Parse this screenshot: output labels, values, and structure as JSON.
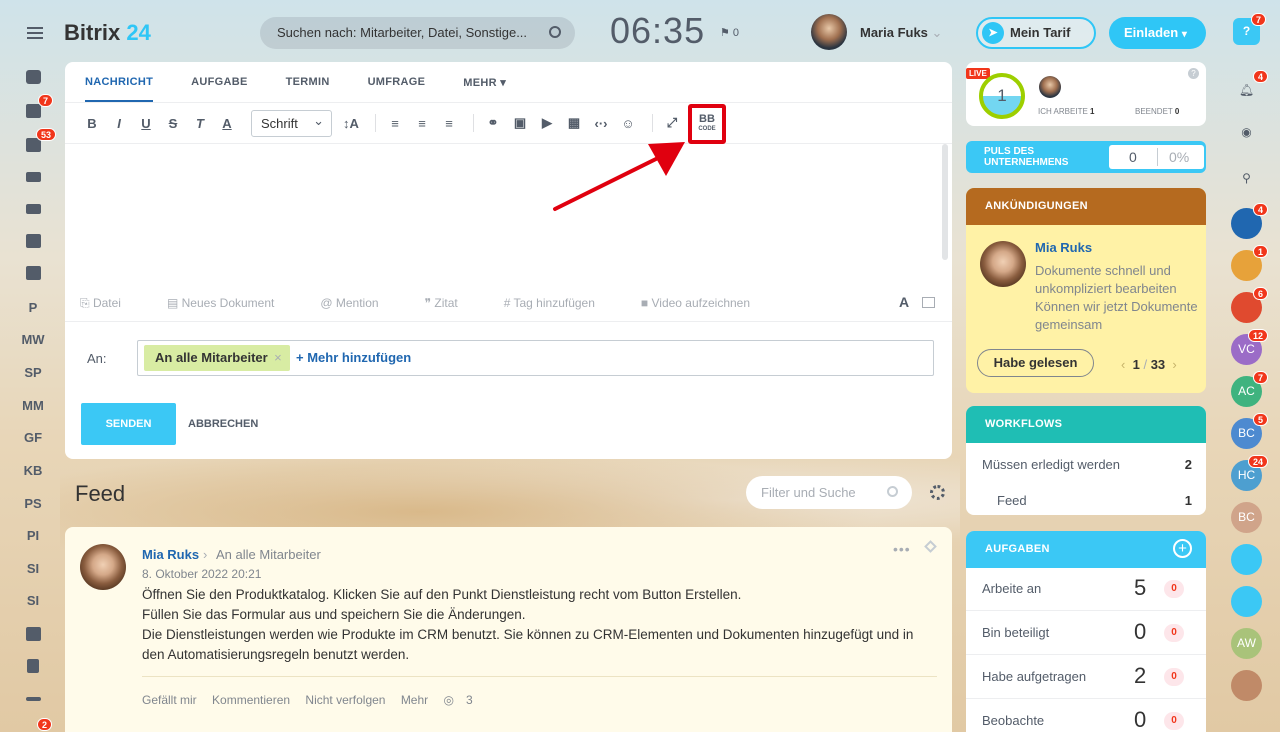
{
  "header": {
    "logo_a": "Bitrix",
    "logo_b": "24",
    "search_placeholder": "Suchen nach: Mitarbeiter, Datei, Sonstige...",
    "clock": "06:35",
    "flag_count": "0",
    "user_name": "Maria Fuks",
    "tarif_label": "Mein Tarif",
    "invite_label": "Einladen"
  },
  "leftbar": {
    "badges": {
      "tasks": "7",
      "chat": "53",
      "bottom": "2"
    },
    "text_items": [
      "P",
      "MW",
      "SP",
      "MM",
      "GF",
      "KB",
      "PS",
      "PI",
      "SI",
      "SI"
    ]
  },
  "composer": {
    "tabs": [
      "NACHRICHT",
      "AUFGABE",
      "TERMIN",
      "UMFRAGE",
      "MEHR ▾"
    ],
    "font_select": "Schrift",
    "bbcode_top": "BB",
    "bbcode_bottom": "CODE",
    "attach": [
      "Datei",
      "Neues Dokument",
      "Mention",
      "Zitat",
      "Tag hinzufügen",
      "Video aufzeichnen"
    ],
    "to_label": "An:",
    "to_tag": "An alle Mitarbeiter",
    "to_add": "+ Mehr hinzufügen",
    "send": "SENDEN",
    "cancel": "ABBRECHEN"
  },
  "feed": {
    "title": "Feed",
    "filter_placeholder": "Filter und Suche",
    "post": {
      "author": "Mia Ruks",
      "to": "An alle Mitarbeiter",
      "date": "8. Oktober 2022 20:21",
      "lines": [
        "Öffnen Sie den Produktkatalog. Klicken Sie auf den Punkt Dienstleistung recht vom Button Erstellen.",
        "Füllen Sie das Formular aus und speichern Sie die Änderungen.",
        "Die Dienstleistungen werden wie Produkte im CRM benutzt. Sie können zu CRM-Elementen und Dokumenten hinzugefügt und in den Automatisierungsregeln benutzt werden."
      ],
      "actions": [
        "Gefällt mir",
        "Kommentieren",
        "Nicht verfolgen",
        "Mehr"
      ],
      "views": "3"
    }
  },
  "right": {
    "live": {
      "tag": "LIVE",
      "count": "1",
      "label_a": "ICH ARBEITE",
      "val_a": "1",
      "label_b": "BEENDET",
      "val_b": "0"
    },
    "puls": {
      "title": "PULS DES UNTERNEHMENS",
      "a": "0",
      "b": "0%"
    },
    "announcements": {
      "title": "ANKÜNDIGUNGEN",
      "name": "Mia Ruks",
      "text": "Dokumente schnell und unkompliziert bearbeiten Können wir jetzt Dokumente gemeinsam",
      "button": "Habe gelesen",
      "page": "1",
      "total": "33"
    },
    "workflows": {
      "title": "WORKFLOWS",
      "rows": [
        {
          "label": "Müssen erledigt werden",
          "value": "2"
        },
        {
          "label": "Feed",
          "value": "1"
        }
      ]
    },
    "tasks": {
      "title": "AUFGABEN",
      "rows": [
        {
          "label": "Arbeite an",
          "value": "5",
          "badge": "0"
        },
        {
          "label": "Bin beteiligt",
          "value": "0",
          "badge": "0"
        },
        {
          "label": "Habe aufgetragen",
          "value": "2",
          "badge": "0"
        },
        {
          "label": "Beobachte",
          "value": "0",
          "badge": "0"
        }
      ]
    }
  },
  "rail": {
    "help_badge": "7",
    "bell_badge": "4",
    "items": [
      {
        "text": "",
        "badge": "4",
        "color": "#2067b0"
      },
      {
        "text": "",
        "badge": "1",
        "color": "#e7a23a"
      },
      {
        "text": "",
        "badge": "6",
        "color": "#e04a2f"
      },
      {
        "text": "VC",
        "badge": "12",
        "color": "#9b6cc7"
      },
      {
        "text": "AC",
        "badge": "7",
        "color": "#3fb37f"
      },
      {
        "text": "BC",
        "badge": "5",
        "color": "#4d8ad0"
      },
      {
        "text": "HC",
        "badge": "24",
        "color": "#4d9fd0"
      },
      {
        "text": "BC",
        "badge": "",
        "color": "#d0a48a"
      },
      {
        "text": "",
        "badge": "",
        "color": "#3bc8f5"
      },
      {
        "text": "",
        "badge": "",
        "color": "#3bc8f5"
      },
      {
        "text": "AW",
        "badge": "",
        "color": "#a9c37a"
      },
      {
        "text": "",
        "badge": "",
        "color": "#c08a68"
      }
    ]
  }
}
